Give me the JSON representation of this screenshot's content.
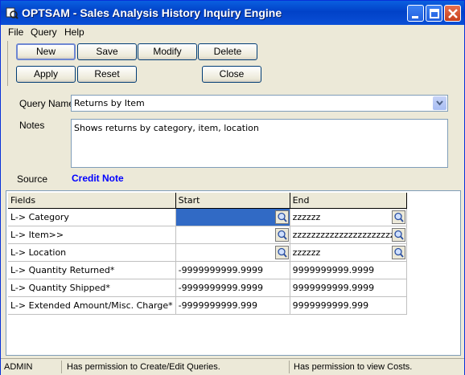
{
  "window": {
    "title": "OPTSAM - Sales Analysis History Inquiry Engine"
  },
  "menu": {
    "file": "File",
    "query": "Query",
    "help": "Help"
  },
  "toolbar": {
    "new": "New",
    "save": "Save",
    "modify": "Modify",
    "delete": "Delete",
    "apply": "Apply",
    "reset": "Reset",
    "close": "Close"
  },
  "form": {
    "query_name_label": "Query Name",
    "query_name_value": "Returns by Item",
    "notes_label": "Notes",
    "notes_value": "Shows returns by category, item, location",
    "source_label": "Source",
    "source_value": "Credit Note"
  },
  "grid": {
    "headers": {
      "fields": "Fields",
      "start": "Start",
      "end": "End"
    },
    "rows": [
      {
        "field": "L-> Category",
        "start": "",
        "end": "zzzzzz",
        "lookup": true
      },
      {
        "field": "L-> Item>>",
        "start": "",
        "end": "zzzzzzzzzzzzzzzzzzzzzzzz",
        "lookup": true
      },
      {
        "field": "L-> Location",
        "start": "",
        "end": "zzzzzz",
        "lookup": true
      },
      {
        "field": "L-> Quantity Returned*",
        "start": "-9999999999.9999",
        "end": "9999999999.9999",
        "lookup": false
      },
      {
        "field": "L-> Quantity Shipped*",
        "start": "-9999999999.9999",
        "end": "9999999999.9999",
        "lookup": false
      },
      {
        "field": "L-> Extended Amount/Misc. Charge*",
        "start": "-9999999999.999",
        "end": "9999999999.999",
        "lookup": false
      }
    ]
  },
  "status": {
    "user": "ADMIN",
    "permission_queries": "Has permission to Create/Edit Queries.",
    "permission_costs": "Has permission to view Costs."
  },
  "colors": {
    "title_bar": "#0142c8",
    "source_value": "#0000ff",
    "selection": "#316ac5"
  },
  "icons": [
    "app-icon",
    "minimize-icon",
    "maximize-icon",
    "close-icon",
    "dropdown-arrow-icon",
    "lookup-magnifier-icon"
  ]
}
